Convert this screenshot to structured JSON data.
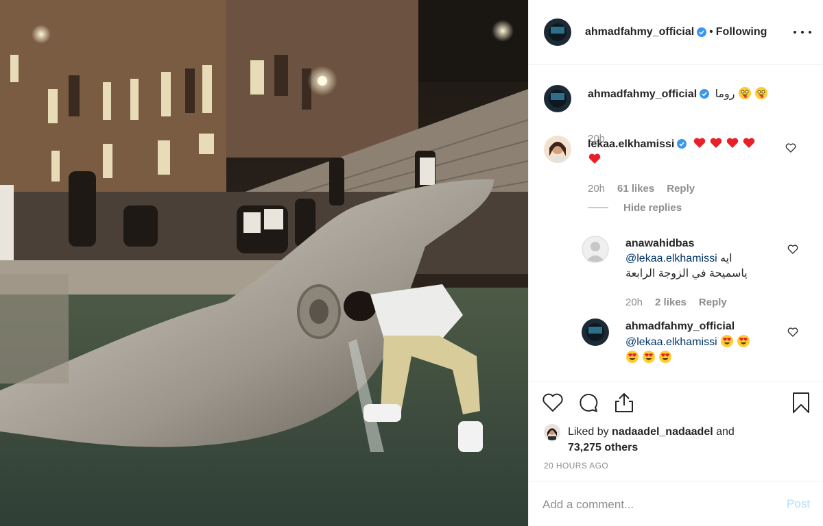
{
  "post": {
    "author": "ahmadfahmy_official",
    "separator": "•",
    "follow_status": "Following"
  },
  "caption": {
    "username": "ahmadfahmy_official",
    "text": "روما",
    "emojis": [
      "tongue-wink-emoji",
      "tongue-wink-emoji"
    ],
    "time": "20h"
  },
  "comments": [
    {
      "username": "lekaa.elkhamissi",
      "emojis": [
        "red-heart-emoji",
        "red-heart-emoji",
        "red-heart-emoji",
        "red-heart-emoji",
        "red-heart-emoji"
      ],
      "time": "20h",
      "likes": "61 likes",
      "reply": "Reply",
      "hide_replies": "Hide replies"
    }
  ],
  "replies": [
    {
      "username": "anawahidbas",
      "mention": "@lekaa.elkhamissi",
      "text_1": "ايه",
      "text_2": "ياسميحة في الزوجة الرابعة",
      "time": "20h",
      "likes": "2 likes",
      "reply": "Reply"
    },
    {
      "username": "ahmadfahmy_official",
      "mention": "@lekaa.elkhamissi",
      "emojis": [
        "heart-eyes-emoji",
        "heart-eyes-emoji",
        "heart-eyes-emoji",
        "heart-eyes-emoji",
        "heart-eyes-emoji"
      ]
    }
  ],
  "engagement": {
    "liked_by_prefix": "Liked by",
    "liked_by_user": "nadaadel_nadaadel",
    "liked_by_and": "and",
    "others": "73,275 others",
    "timestamp": "20 HOURS AGO"
  },
  "add_comment": {
    "placeholder": "Add a comment...",
    "post_label": "Post"
  },
  "colors": {
    "verified": "#3897f0",
    "text": "#262626",
    "muted": "#8e8e8e",
    "mention": "#003569",
    "post_disabled": "#b2dffc",
    "heart": "#ed1c24"
  },
  "icons": [
    "more-options-icon",
    "verified-badge-icon",
    "heart-icon",
    "comment-icon",
    "share-icon",
    "bookmark-icon"
  ]
}
